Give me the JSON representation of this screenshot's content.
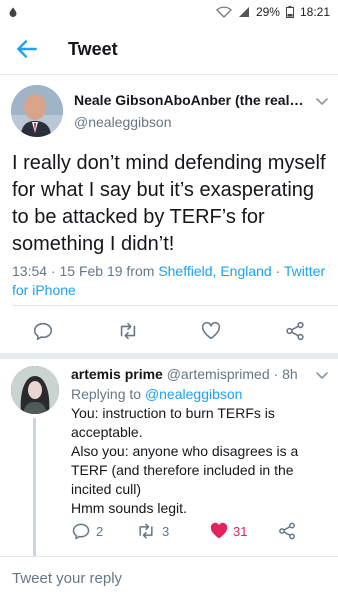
{
  "status": {
    "battery": "29%",
    "time": "18:21"
  },
  "appbar": {
    "title": "Tweet"
  },
  "main_tweet": {
    "author_name": "Neale GibsonAboAnber (the real on...",
    "author_handle": "@nealeggibson",
    "text": "I really don’t mind defending myself for what I say but it’s exasperating to be attacked by TERF’s for something I didn’t!",
    "timestamp": "13:54 · 15 Feb 19 from ",
    "location": "Sheffield, England",
    "separator": " · ",
    "client": "Twitter for iPhone"
  },
  "reply": {
    "author_name": "artemis prime",
    "author_handle": "@artemisprimed",
    "age": " · 8h",
    "replying_prefix": "Replying to ",
    "replying_to": "@nealeggibson",
    "lines": [
      "You: instruction to burn TERFs is acceptable.",
      "Also you: anyone who disagrees is a TERF (and therefore included in the incited cull)",
      "Hmm sounds legit."
    ],
    "reply_count": "2",
    "retweet_count": "3",
    "like_count": "31"
  },
  "compose": {
    "placeholder": "Tweet your reply"
  },
  "colors": {
    "accent": "#1da1f2",
    "like": "#e0245e",
    "muted": "#657786",
    "text": "#14171a"
  },
  "icons": [
    "back-arrow-icon",
    "reply-icon",
    "retweet-icon",
    "like-icon",
    "share-icon",
    "chevron-down-icon"
  ]
}
